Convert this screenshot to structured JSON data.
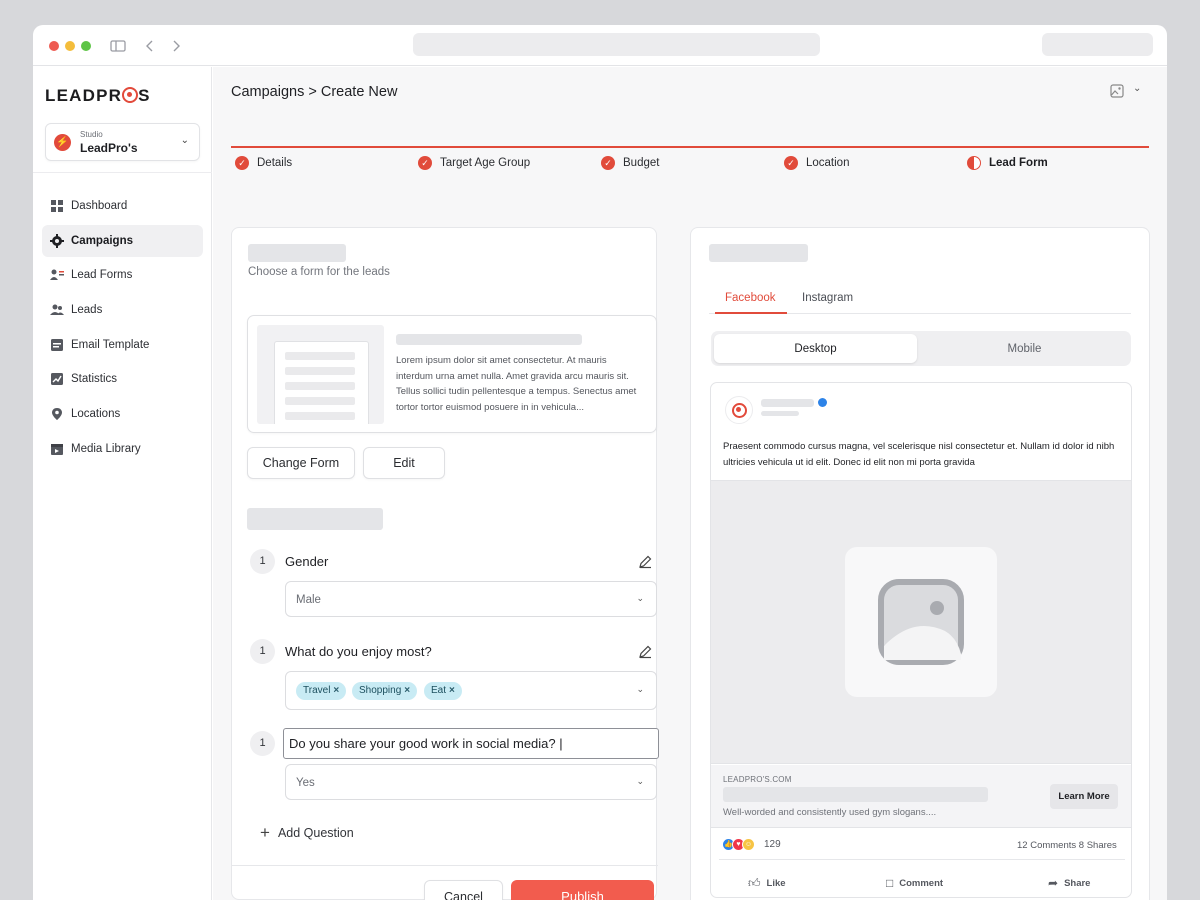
{
  "app": {
    "logo_text": "LEADPR",
    "logo_tail": "S"
  },
  "studio": {
    "label": "Studio",
    "value": "LeadPro's"
  },
  "sidebar": {
    "items": [
      {
        "label": "Dashboard",
        "icon": "dashboard-icon",
        "active": false
      },
      {
        "label": "Campaigns",
        "icon": "gear-icon",
        "active": true
      },
      {
        "label": "Lead Forms",
        "icon": "lead-forms-icon",
        "active": false
      },
      {
        "label": "Leads",
        "icon": "users-icon",
        "active": false
      },
      {
        "label": "Email Template",
        "icon": "email-icon",
        "active": false
      },
      {
        "label": "Statistics",
        "icon": "chart-icon",
        "active": false
      },
      {
        "label": "Locations",
        "icon": "location-pin-icon",
        "active": false
      },
      {
        "label": "Media Library",
        "icon": "media-icon",
        "active": false
      }
    ]
  },
  "header": {
    "breadcrumb": "Campaigns > Create New"
  },
  "steps": [
    {
      "label": "Details",
      "state": "done"
    },
    {
      "label": "Target Age Group",
      "state": "done"
    },
    {
      "label": "Budget",
      "state": "done"
    },
    {
      "label": "Location",
      "state": "done"
    },
    {
      "label": "Lead Form",
      "state": "current"
    }
  ],
  "form_panel": {
    "subtitle": "Choose a form for the leads",
    "preview_text": "Lorem ipsum dolor sit amet consectetur. At mauris interdum urna amet nulla. Amet gravida arcu mauris sit. Tellus sollici tudin pellentesque a tempus. Senectus amet tortor tortor euismod posuere in in vehicula...",
    "change_form_label": "Change Form",
    "edit_label": "Edit",
    "questions": [
      {
        "number": "1",
        "label": "Gender",
        "value": "Male"
      },
      {
        "number": "1",
        "label": "What do you enjoy most?",
        "chips": [
          "Travel",
          "Shopping",
          "Eat"
        ]
      },
      {
        "number": "1",
        "input_value": "Do you share your good work in social media? |",
        "value": "Yes"
      }
    ],
    "add_question_label": "Add Question",
    "cancel_label": "Cancel",
    "publish_label": "Publish"
  },
  "preview_panel": {
    "tabs": [
      "Facebook",
      "Instagram"
    ],
    "active_tab": "Facebook",
    "devices": [
      "Desktop",
      "Mobile"
    ],
    "active_device": "Desktop",
    "post": {
      "text": "Praesent commodo cursus magna, vel scelerisque nisl consectetur et. Nullam id dolor id nibh ultricies vehicula ut id elit. Donec id elit non mi porta gravida",
      "domain": "LEADPRO'S.COM",
      "description": "Well-worded and consistently used gym slogans....",
      "cta_label": "Learn More",
      "reaction_count": "129",
      "comments_shares": "12 Comments  8 Shares",
      "actions": [
        "Like",
        "Comment",
        "Share"
      ]
    }
  },
  "colors": {
    "accent": "#e14b3b",
    "publish": "#f25c4e",
    "chip_bg": "#c8ebf4"
  }
}
